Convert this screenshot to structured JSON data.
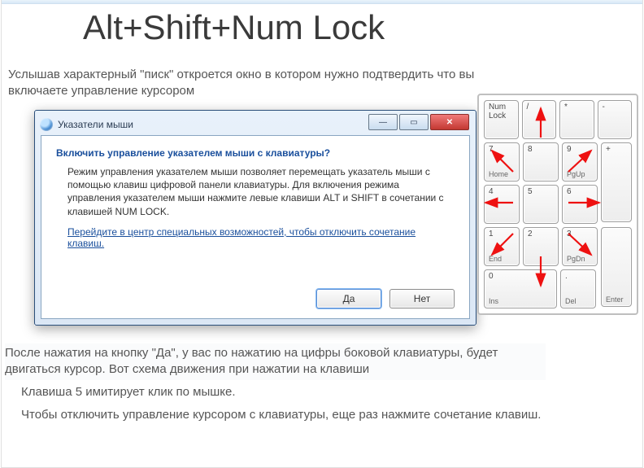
{
  "title": "Alt+Shift+Num Lock",
  "intro": "Услышав характерный \"писк\" откроется окно в котором нужно подтвердить что вы включаете управление курсором",
  "dialog": {
    "title": "Указатели мыши",
    "minimize_glyph": "—",
    "maximize_glyph": "▭",
    "close_glyph": "✕",
    "heading": "Включить управление указателем мыши с клавиатуры?",
    "body": "Режим управления указателем мыши позволяет перемещать указатель мыши с помощью клавиш цифровой панели клавиатуры.  Для включения режима управления указателем мыши нажмите левые клавиши ALT и SHIFT в сочетании с клавишей NUM LOCK.",
    "link": "Перейдите в центр специальных возможностей, чтобы отключить сочетание клавиш.",
    "yes_label": "Да",
    "no_label": "Нет"
  },
  "after": "После нажатия на кнопку \"Да\", у вас по нажатию на цифры боковой клавиатуры, будет двигаться курсор. Вот схема движения при нажатии на клавиши",
  "note_click": "Клавиша 5 имитирует клик по мышке.",
  "note_disable": "Чтобы отключить управление курсором с клавиатуры, еще раз нажмите сочетание клавиш.",
  "numpad": {
    "r1": [
      {
        "t": "Num\nLock",
        "b": ""
      },
      {
        "t": "/",
        "b": ""
      },
      {
        "t": "*",
        "b": ""
      },
      {
        "t": "-",
        "b": ""
      }
    ],
    "r2": [
      {
        "t": "7",
        "b": "Home"
      },
      {
        "t": "8",
        "b": ""
      },
      {
        "t": "9",
        "b": "PgUp"
      }
    ],
    "plus": {
      "t": "+",
      "b": ""
    },
    "r3": [
      {
        "t": "4",
        "b": ""
      },
      {
        "t": "5",
        "b": ""
      },
      {
        "t": "6",
        "b": ""
      }
    ],
    "r4": [
      {
        "t": "1",
        "b": "End"
      },
      {
        "t": "2",
        "b": ""
      },
      {
        "t": "3",
        "b": "PgDn"
      }
    ],
    "enter": {
      "t": "",
      "b": "Enter"
    },
    "r5": [
      {
        "t": "0",
        "b": "Ins"
      },
      {
        "t": ".",
        "b": "Del"
      }
    ]
  }
}
